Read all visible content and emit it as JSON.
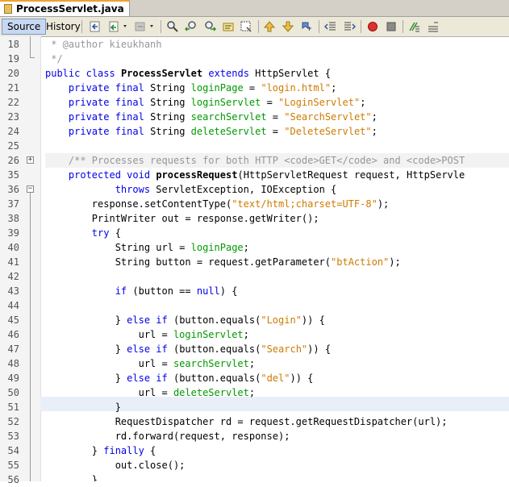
{
  "editor_tab": {
    "title": "ProcessServlet.java"
  },
  "toolbar": {
    "source_label": "Source",
    "history_label": "History",
    "icons": [
      "last-edit-icon",
      "back-icon",
      "forward-icon",
      "find-icon",
      "find-previous-icon",
      "find-next-icon",
      "find-selection-icon",
      "toggle-highlight-icon",
      "previous-bookmark-icon",
      "next-bookmark-icon",
      "toggle-bookmark-icon",
      "shift-left-icon",
      "shift-right-icon",
      "start-macro-icon",
      "stop-macro-icon",
      "comment-icon",
      "uncomment-icon"
    ]
  },
  "code_lines": [
    {
      "num": "18",
      "text": " * @author kieukhanh"
    },
    {
      "num": "19",
      "text": " */"
    },
    {
      "num": "20",
      "text": "public class ProcessServlet extends HttpServlet {"
    },
    {
      "num": "21",
      "text": "    private final String loginPage = \"login.html\";"
    },
    {
      "num": "22",
      "text": "    private final String loginServlet = \"LoginServlet\";"
    },
    {
      "num": "23",
      "text": "    private final String searchServlet = \"SearchServlet\";"
    },
    {
      "num": "24",
      "text": "    private final String deleteServlet = \"DeleteServlet\";"
    },
    {
      "num": "25",
      "text": ""
    },
    {
      "num": "26",
      "text": "    /** Processes requests for both HTTP <code>GET</code> and <code>POST"
    },
    {
      "num": "35",
      "text": "    protected void processRequest(HttpServletRequest request, HttpServle"
    },
    {
      "num": "36",
      "text": "            throws ServletException, IOException {"
    },
    {
      "num": "37",
      "text": "        response.setContentType(\"text/html;charset=UTF-8\");"
    },
    {
      "num": "38",
      "text": "        PrintWriter out = response.getWriter();"
    },
    {
      "num": "39",
      "text": "        try {"
    },
    {
      "num": "40",
      "text": "            String url = loginPage;"
    },
    {
      "num": "41",
      "text": "            String button = request.getParameter(\"btAction\");"
    },
    {
      "num": "42",
      "text": ""
    },
    {
      "num": "43",
      "text": "            if (button == null) {"
    },
    {
      "num": "44",
      "text": ""
    },
    {
      "num": "45",
      "text": "            } else if (button.equals(\"Login\")) {"
    },
    {
      "num": "46",
      "text": "                url = loginServlet;"
    },
    {
      "num": "47",
      "text": "            } else if (button.equals(\"Search\")) {"
    },
    {
      "num": "48",
      "text": "                url = searchServlet;"
    },
    {
      "num": "49",
      "text": "            } else if (button.equals(\"del\")) {"
    },
    {
      "num": "50",
      "text": "                url = deleteServlet;"
    },
    {
      "num": "51",
      "text": "            }"
    },
    {
      "num": "52",
      "text": "            RequestDispatcher rd = request.getRequestDispatcher(url);"
    },
    {
      "num": "53",
      "text": "            rd.forward(request, response);"
    },
    {
      "num": "54",
      "text": "        } finally {"
    },
    {
      "num": "55",
      "text": "            out.close();"
    },
    {
      "num": "56",
      "text": "        }"
    }
  ],
  "colors": {
    "keyword": "#0000e6",
    "string": "#ce7b00",
    "field": "#009900",
    "comment": "#969696",
    "current_line": "#e9eff8"
  }
}
